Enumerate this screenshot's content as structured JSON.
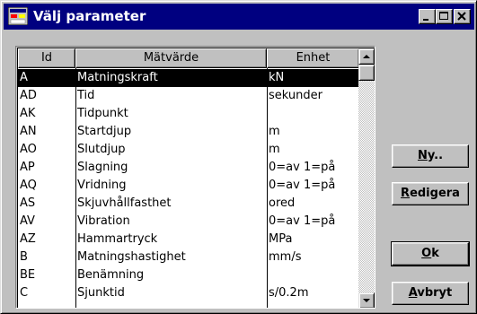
{
  "window": {
    "title": "Välj parameter",
    "minimize_label": "minimize",
    "maximize_label": "maximize",
    "close_label": "close"
  },
  "list": {
    "columns": [
      "Id",
      "Mätvärde",
      "Enhet"
    ],
    "selected_index": 0,
    "rows": [
      {
        "id": "A",
        "name": "Matningskraft",
        "unit": "kN"
      },
      {
        "id": "AD",
        "name": "Tid",
        "unit": "sekunder"
      },
      {
        "id": "AK",
        "name": "Tidpunkt",
        "unit": ""
      },
      {
        "id": "AN",
        "name": "Startdjup",
        "unit": "m"
      },
      {
        "id": "AO",
        "name": "Slutdjup",
        "unit": "m"
      },
      {
        "id": "AP",
        "name": "Slagning",
        "unit": "0=av 1=på"
      },
      {
        "id": "AQ",
        "name": "Vridning",
        "unit": "0=av 1=på"
      },
      {
        "id": "AS",
        "name": "Skjuvhållfasthet",
        "unit": "ored"
      },
      {
        "id": "AV",
        "name": "Vibration",
        "unit": "0=av 1=på"
      },
      {
        "id": "AZ",
        "name": "Hammartryck",
        "unit": "MPa"
      },
      {
        "id": "B",
        "name": "Matningshastighet",
        "unit": "mm/s"
      },
      {
        "id": "BE",
        "name": "Benämning",
        "unit": ""
      },
      {
        "id": "C",
        "name": "Sjunktid",
        "unit": "s/0.2m"
      }
    ]
  },
  "buttons": {
    "ny": {
      "mnemonic": "N",
      "rest": "y.."
    },
    "redigera": {
      "mnemonic": "R",
      "rest": "edigera"
    },
    "ok": {
      "mnemonic": "O",
      "rest": "k"
    },
    "avbryt": {
      "mnemonic": "A",
      "rest": "vbryt"
    }
  },
  "icons": {
    "app": "app-icon",
    "scroll_up": "arrow-up-icon",
    "scroll_down": "arrow-down-icon"
  },
  "colors": {
    "titlebar": "#000080",
    "face": "#c0c0c0",
    "selection": "#000000"
  }
}
